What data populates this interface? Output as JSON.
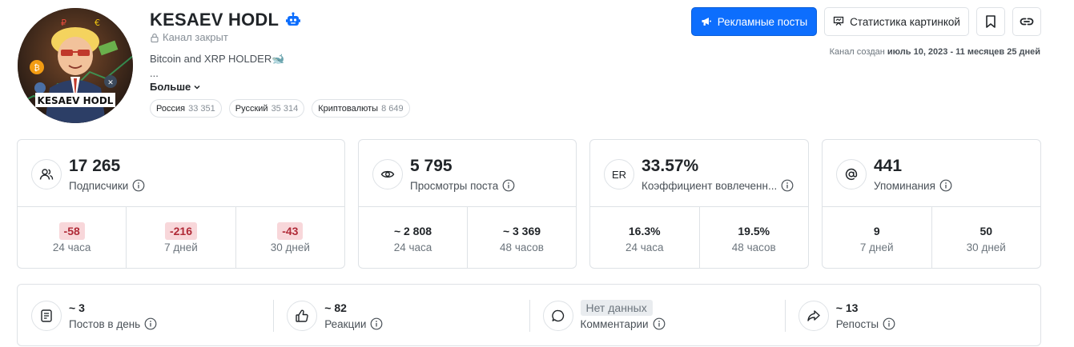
{
  "channel": {
    "title": "KESAEV HODL",
    "status": "Канал закрыт",
    "description": "Bitcoin and XRP HOLDER🐋",
    "ellipsis": "...",
    "more_label": "Больше",
    "avatar_caption": "KESAEV HODL",
    "tags": [
      {
        "name": "Россия",
        "count": "33 351"
      },
      {
        "name": "Русский",
        "count": "35 314"
      },
      {
        "name": "Криптовалюты",
        "count": "8 649"
      }
    ],
    "created_label": "Канал создан",
    "created_value": "июль 10, 2023 - 11 месяцев 25 дней"
  },
  "actions": {
    "ads_label": "Рекламные посты",
    "stats_label": "Статистика картинкой"
  },
  "icons": {
    "bot": "bot-icon",
    "lock": "lock-icon",
    "chevron": "chevron-down-icon",
    "ads": "megaphone-icon",
    "stats": "presentation-icon",
    "bookmark": "bookmark-icon",
    "link": "link-icon",
    "info": "info-icon",
    "subscribers": "users-icon",
    "views": "eye-icon",
    "mentions": "at-icon",
    "posts": "document-icon",
    "reactions": "thumbs-up-icon",
    "comments": "comment-icon",
    "reposts": "share-icon"
  },
  "colors": {
    "primary": "#0d6efd",
    "negative_bg": "#f8d7da",
    "negative_text": "#b02a37"
  },
  "cards": {
    "subscribers": {
      "value": "17 265",
      "label": "Подписчики",
      "cells": [
        {
          "value": "-58",
          "label": "24 часа"
        },
        {
          "value": "-216",
          "label": "7 дней"
        },
        {
          "value": "-43",
          "label": "30 дней"
        }
      ]
    },
    "views": {
      "value": "5 795",
      "label": "Просмотры поста",
      "cells": [
        {
          "value": "~ 2 808",
          "label": "24 часа"
        },
        {
          "value": "~ 3 369",
          "label": "48 часов"
        }
      ]
    },
    "er": {
      "icon_text": "ER",
      "value": "33.57%",
      "label": "Коэффициент вовлеченн...",
      "cells": [
        {
          "value": "16.3%",
          "label": "24 часа"
        },
        {
          "value": "19.5%",
          "label": "48 часов"
        }
      ]
    },
    "mentions": {
      "value": "441",
      "label": "Упоминания",
      "cells": [
        {
          "value": "9",
          "label": "7 дней"
        },
        {
          "value": "50",
          "label": "30 дней"
        }
      ]
    }
  },
  "bar": {
    "posts": {
      "value": "~ 3",
      "label": "Постов в день"
    },
    "reactions": {
      "value": "~ 82",
      "label": "Реакции"
    },
    "comments": {
      "value": "Нет данных",
      "label": "Комментарии"
    },
    "reposts": {
      "value": "~ 13",
      "label": "Репосты"
    }
  }
}
